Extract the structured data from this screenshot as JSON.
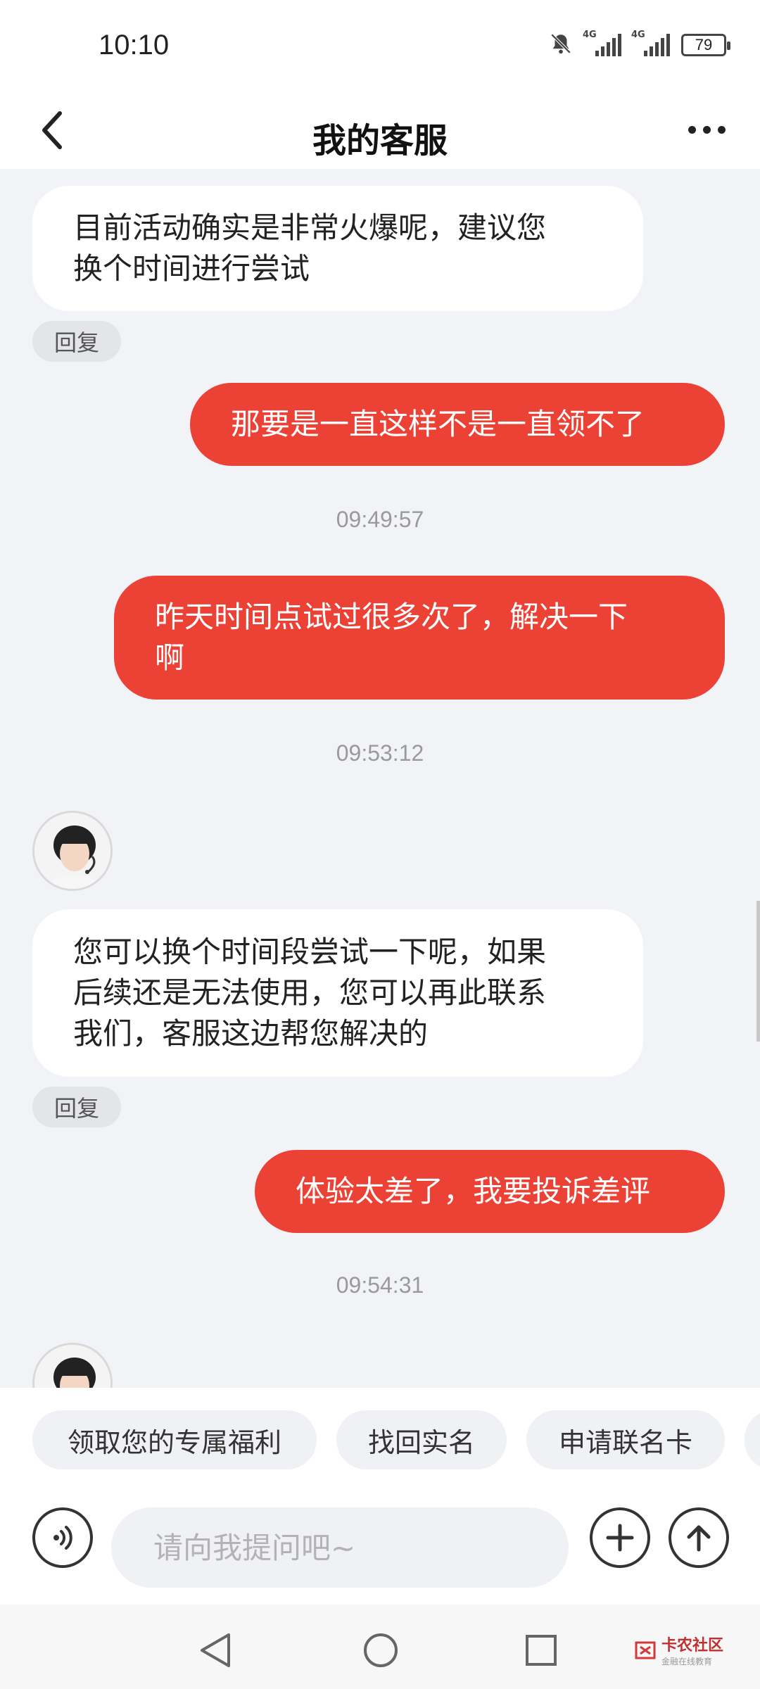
{
  "status_bar": {
    "time": "10:10",
    "network_1": "4G",
    "network_2": "4G",
    "battery": "79",
    "icons": [
      "bell-off-icon",
      "signal-icon",
      "signal-icon",
      "battery-icon"
    ]
  },
  "header": {
    "title": "我的客服",
    "back_icon": "chevron-left-icon",
    "more_icon": "more-dots-icon"
  },
  "messages": [
    {
      "type": "agent",
      "lines": [
        "目前活动确实是非常火爆呢，建议您",
        "换个时间进行尝试"
      ]
    },
    {
      "type": "user",
      "lines": [
        "那要是一直这样不是一直领不了"
      ]
    },
    {
      "type": "timestamp",
      "text": "09:49:57"
    },
    {
      "type": "user",
      "lines": [
        "昨天时间点试过很多次了，解决一下",
        "啊"
      ]
    },
    {
      "type": "timestamp",
      "text": "09:53:12"
    },
    {
      "type": "agent",
      "lines": [
        "您可以换个时间段尝试一下呢，如果",
        "后续还是无法使用，您可以再此联系",
        "我们，客服这边帮您解决的"
      ]
    },
    {
      "type": "user",
      "lines": [
        "体验太差了，我要投诉差评"
      ]
    },
    {
      "type": "timestamp",
      "text": "09:54:31"
    }
  ],
  "reply_label": "回复",
  "quick_replies": [
    "领取您的专属福利",
    "找回实名",
    "申请联名卡"
  ],
  "input": {
    "placeholder": "请向我提问吧~",
    "value": ""
  },
  "nav": [
    "back-triangle-icon",
    "home-circle-icon",
    "recents-square-icon"
  ],
  "watermark": {
    "title": "卡农社区",
    "subtitle": "金融在线教育"
  },
  "colors": {
    "accent": "#ec4236",
    "background": "#f2f3f7"
  }
}
